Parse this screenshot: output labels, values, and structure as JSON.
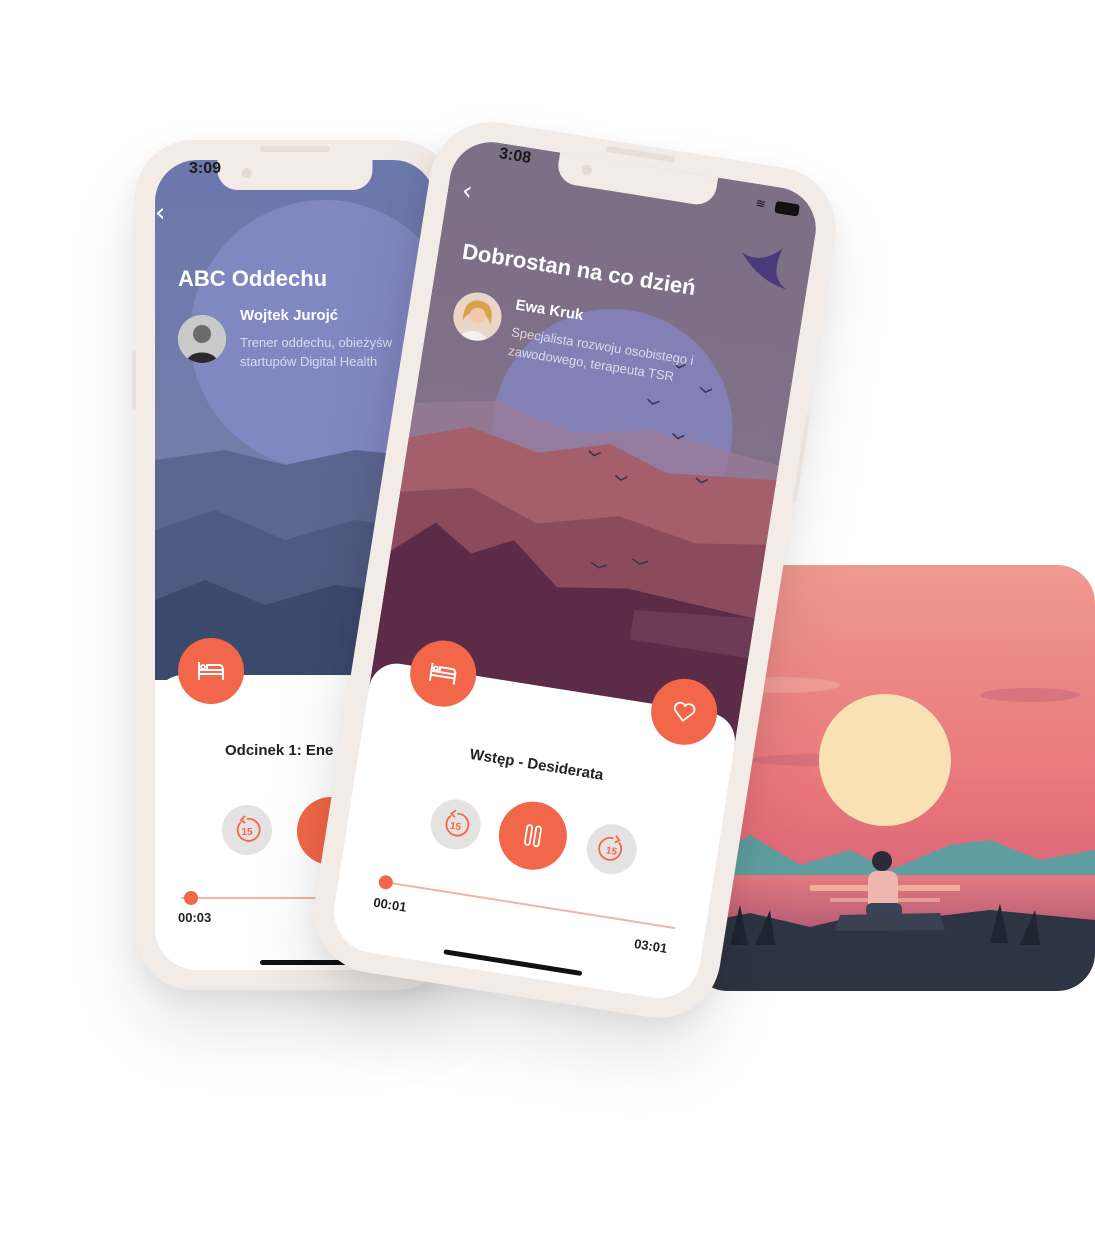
{
  "icons": {
    "bed": "bed-icon",
    "heart": "heart-icon",
    "back": "chevron-left-icon",
    "skip_back": "rewind-15-icon",
    "skip_forward": "forward-15-icon",
    "pause": "pause-icon",
    "wifi": "wifi-icon",
    "battery": "battery-icon"
  },
  "colors": {
    "accent": "#f26749",
    "phone_frame": "#f3ece6",
    "skip_button_bg": "#e5e2e2"
  },
  "back_phone": {
    "status_time": "3:09",
    "back_glyph": "‹",
    "title": "ABC Oddechu",
    "author_name": "Wojtek Jurojć",
    "author_desc_line1": "Trener oddechu, obieżyśw",
    "author_desc_line2": "startupów Digital Health",
    "episode_title": "Odcinek 1: Ene",
    "skip_back_label": "15",
    "elapsed": "00:03",
    "progress": 0.03
  },
  "front_phone": {
    "status_time": "3:08",
    "back_glyph": "‹",
    "title": "Dobrostan na co dzień",
    "author_name": "Ewa Kruk",
    "author_desc_line1": "Specjalista rozwoju osobistego i",
    "author_desc_line2": "zawodowego, terapeuta TSR",
    "episode_title": "Wstęp - Desiderata",
    "skip_back_label": "15",
    "skip_forward_label": "15",
    "elapsed": "00:01",
    "total": "03:01",
    "progress": 0.01
  }
}
